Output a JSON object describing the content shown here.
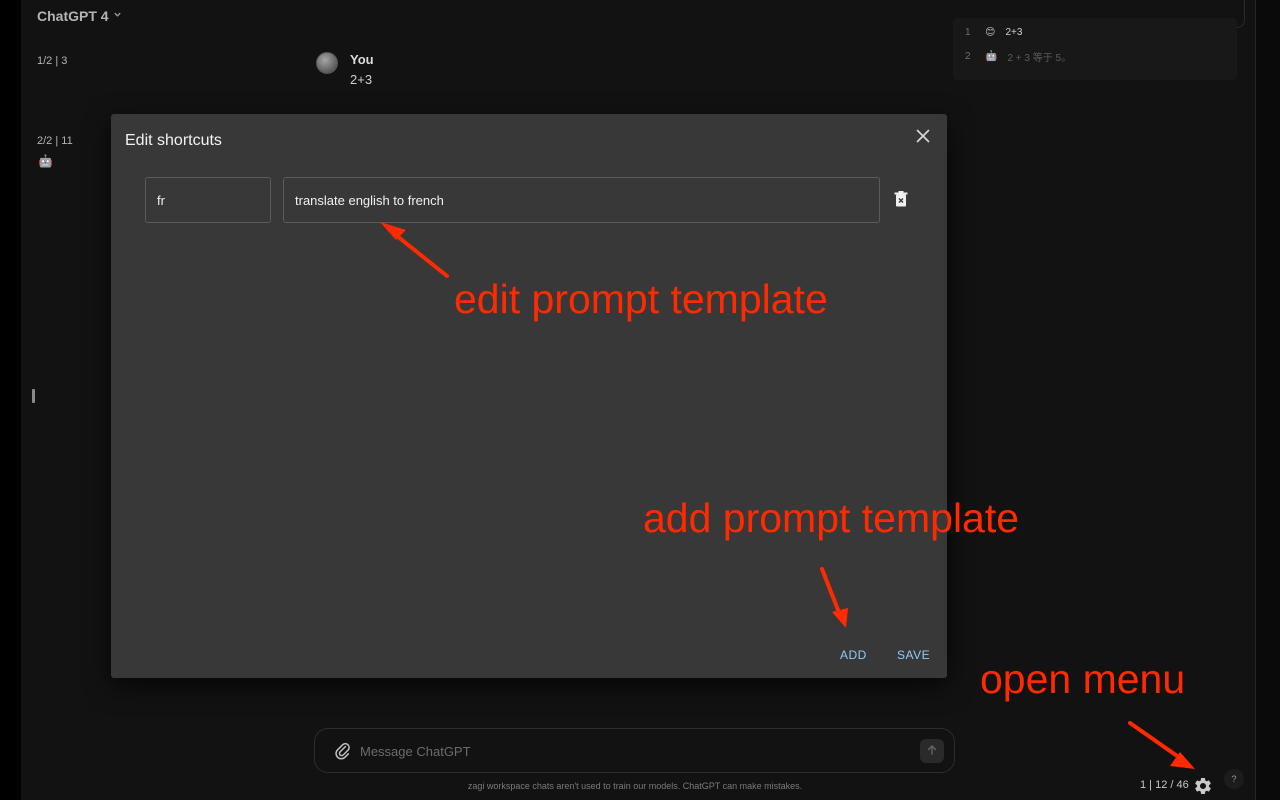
{
  "header": {
    "model_label": "ChatGPT 4"
  },
  "thread": {
    "indices": [
      {
        "label": "1/2 | 3"
      },
      {
        "label": "2/2 | 11"
      }
    ],
    "bot_icon": "🤖",
    "user_message": {
      "author": "You",
      "text": "2+3"
    }
  },
  "toc": {
    "items": [
      {
        "num": "1",
        "emoji": "😊",
        "text": "2+3"
      },
      {
        "num": "2",
        "emoji": "🤖",
        "text": "2 + 3 等于 5。"
      }
    ]
  },
  "composer": {
    "placeholder": "Message ChatGPT"
  },
  "footer": {
    "disclaimer": "zagi workspace chats aren't used to train our models. ChatGPT can make mistakes.",
    "counter": "1 | 12 / 46",
    "help_label": "?"
  },
  "dialog": {
    "title": "Edit shortcuts",
    "shortcut_key": "fr",
    "shortcut_template": "translate english to french",
    "add_label": "ADD",
    "save_label": "SAVE"
  },
  "annotations": {
    "edit": "edit prompt template",
    "add": "add prompt template",
    "menu": "open menu"
  },
  "colors": {
    "annotation": "#ff2a00",
    "dialog_bg": "#383838",
    "button_text": "#90caf9",
    "app_bg": "#121212"
  },
  "icons": [
    "chevron-down-icon",
    "avatar",
    "robot-icon",
    "paperclip-icon",
    "arrow-up-icon",
    "close-icon",
    "trash-icon",
    "gear-icon",
    "help-icon"
  ]
}
